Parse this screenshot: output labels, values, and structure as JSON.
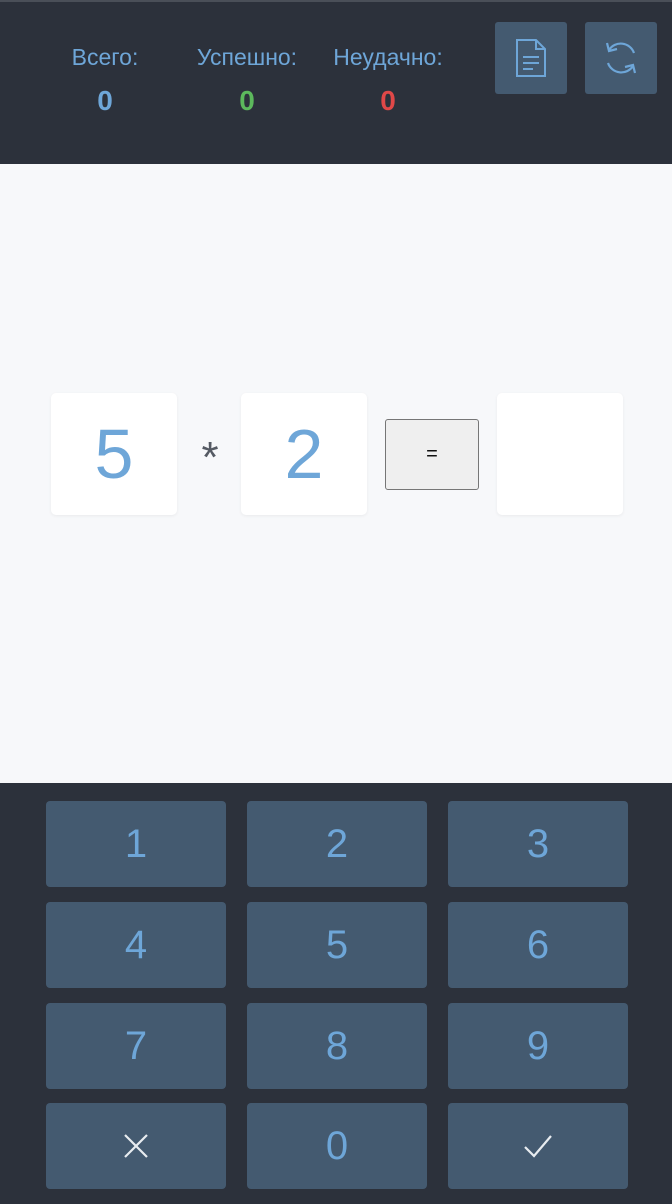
{
  "stats": {
    "total": {
      "label": "Всего:",
      "value": "0",
      "color": "#6ea6d8"
    },
    "success": {
      "label": "Успешно:",
      "value": "0",
      "color": "#5cb85c"
    },
    "fail": {
      "label": "Неудачно:",
      "value": "0",
      "color": "#e04848"
    }
  },
  "header_buttons": {
    "doc_icon": "document-icon",
    "refresh_icon": "refresh-icon"
  },
  "problem": {
    "operand_a": "5",
    "operator": "*",
    "operand_b": "2",
    "equals_label": "=",
    "answer": ""
  },
  "keypad": {
    "keys": [
      "1",
      "2",
      "3",
      "4",
      "5",
      "6",
      "7",
      "8",
      "9",
      "✕",
      "0",
      "✓"
    ],
    "clear_icon": "clear-icon",
    "submit_icon": "check-icon"
  },
  "colors": {
    "accent": "#6ea6d8",
    "panel": "#2c313b",
    "key_bg": "#445a70"
  }
}
